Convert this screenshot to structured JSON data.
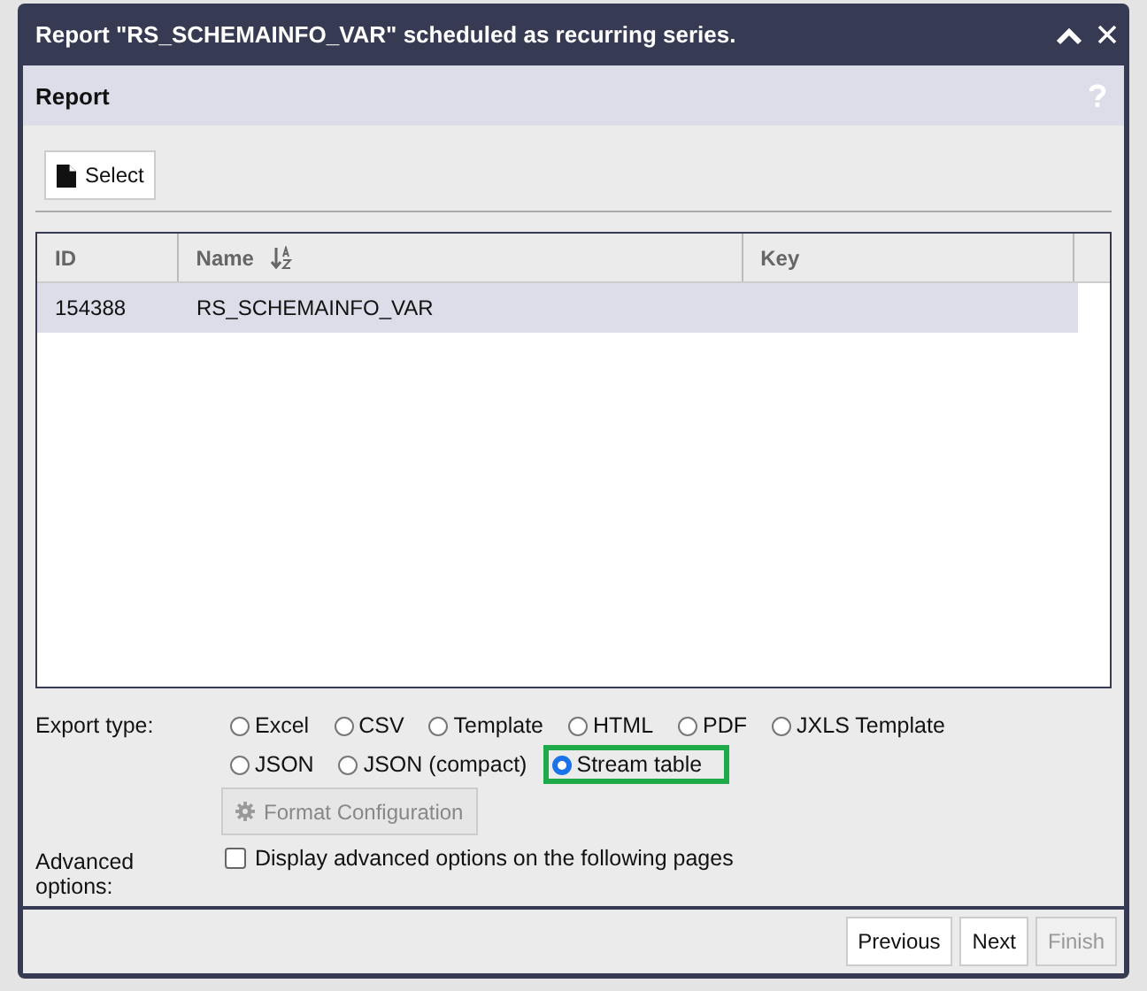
{
  "window": {
    "title": "Report \"RS_SCHEMAINFO_VAR\" scheduled as recurring series."
  },
  "section": {
    "title": "Report"
  },
  "select_button": "Select",
  "table": {
    "columns": [
      {
        "label": "ID",
        "sortable": false
      },
      {
        "label": "Name",
        "sortable": true
      },
      {
        "label": "Key",
        "sortable": false
      }
    ],
    "rows": [
      {
        "cells": [
          "154388",
          "RS_SCHEMAINFO_VAR",
          ""
        ],
        "selected": true
      }
    ]
  },
  "export_type": {
    "label": "Export type:",
    "options": [
      {
        "label": "Excel",
        "selected": false,
        "highlighted": false
      },
      {
        "label": "CSV",
        "selected": false,
        "highlighted": false
      },
      {
        "label": "Template",
        "selected": false,
        "highlighted": false
      },
      {
        "label": "HTML",
        "selected": false,
        "highlighted": false
      },
      {
        "label": "PDF",
        "selected": false,
        "highlighted": false
      },
      {
        "label": "JXLS Template",
        "selected": false,
        "highlighted": false
      },
      {
        "label": "JSON",
        "selected": false,
        "highlighted": false
      },
      {
        "label": "JSON (compact)",
        "selected": false,
        "highlighted": false
      },
      {
        "label": "Stream table",
        "selected": true,
        "highlighted": true
      }
    ],
    "format_button": {
      "label": "Format Configuration",
      "disabled": true
    }
  },
  "advanced": {
    "label": "Advanced options:",
    "checkbox": {
      "label": "Display advanced options on the following pages",
      "checked": false
    }
  },
  "footer_buttons": [
    {
      "label": "Previous",
      "disabled": false
    },
    {
      "label": "Next",
      "disabled": false
    },
    {
      "label": "Finish",
      "disabled": true
    }
  ]
}
